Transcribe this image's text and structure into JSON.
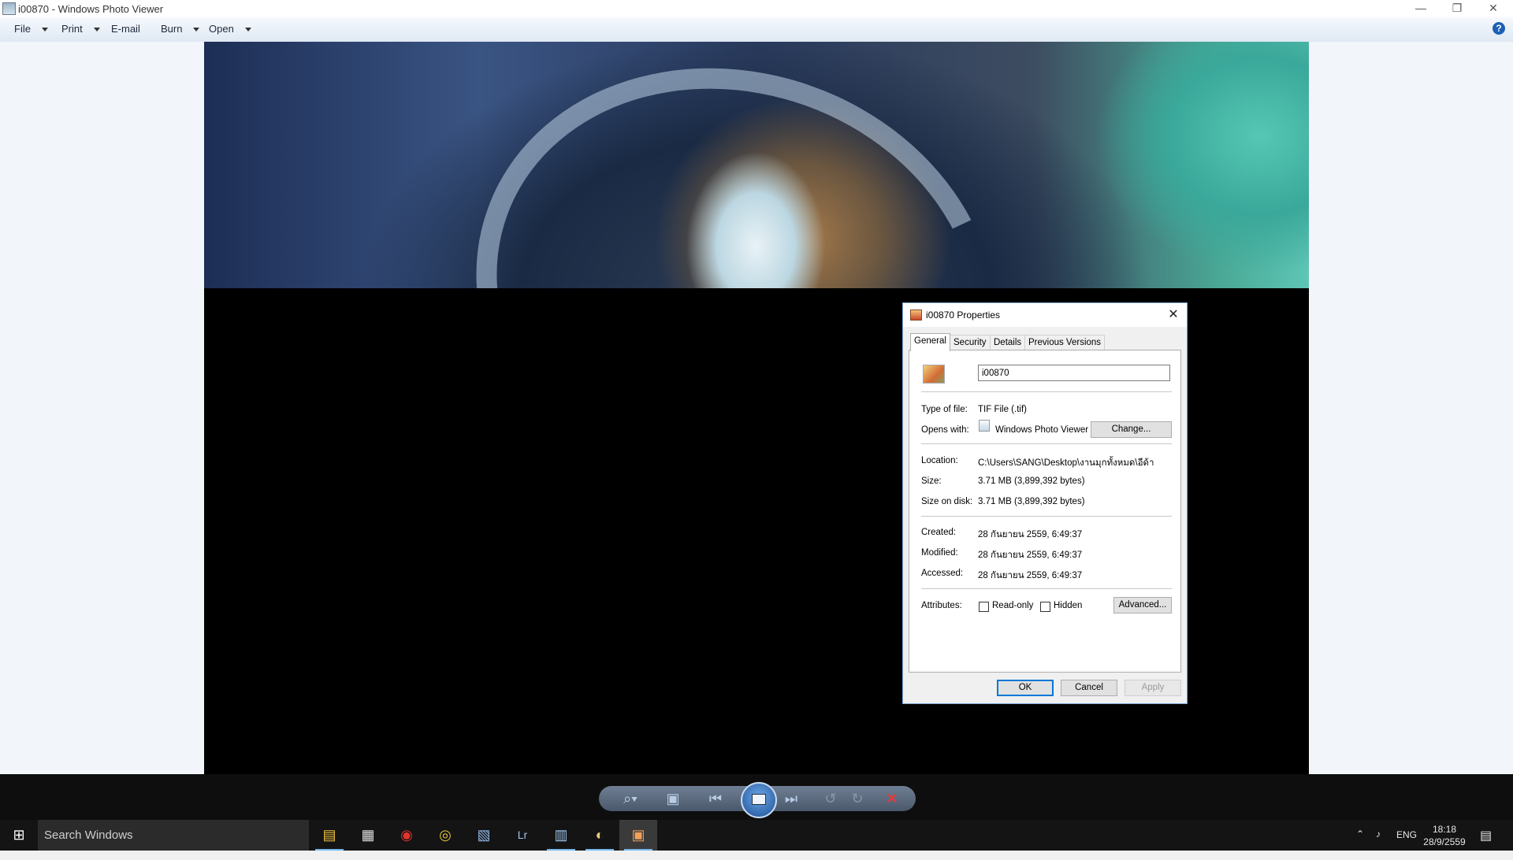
{
  "window": {
    "title": "i00870 - Windows Photo Viewer",
    "minimize": "—",
    "restore": "❐",
    "close": "✕"
  },
  "menu": {
    "items": [
      "File",
      "Print",
      "E-mail",
      "Burn",
      "Open"
    ],
    "help": "?"
  },
  "dialog": {
    "title": "i00870 Properties",
    "close": "✕",
    "tabs": [
      "General",
      "Security",
      "Details",
      "Previous Versions"
    ],
    "file_name": "i00870",
    "fields": {
      "type_label": "Type of file:",
      "type_value": "TIF File (.tif)",
      "opens_label": "Opens with:",
      "opens_value": "Windows Photo Viewer",
      "change_button": "Change...",
      "location_label": "Location:",
      "location_value": "C:\\Users\\SANG\\Desktop\\งานมุกทั้งหมด\\อีด้า",
      "size_label": "Size:",
      "size_value": "3.71 MB (3,899,392 bytes)",
      "size_disk_label": "Size on disk:",
      "size_disk_value": "3.71 MB (3,899,392 bytes)",
      "created_label": "Created:",
      "created_value": "28 กันยายน 2559, 6:49:37",
      "modified_label": "Modified:",
      "modified_value": "28 กันยายน 2559, 6:49:37",
      "accessed_label": "Accessed:",
      "accessed_value": "28 กันยายน 2559, 6:49:37",
      "attributes_label": "Attributes:",
      "readonly_label": "Read-only",
      "hidden_label": "Hidden",
      "advanced_button": "Advanced..."
    },
    "buttons": {
      "ok": "OK",
      "cancel": "Cancel",
      "apply": "Apply"
    }
  },
  "controls": {
    "zoom": "⌕▾",
    "fit": "▣",
    "previous": "⏮",
    "next": "⏭",
    "rotate_ccw": "↺",
    "rotate_cw": "↻",
    "delete": "✕"
  },
  "taskbar": {
    "start": "⊞",
    "search_placeholder": "Search Windows",
    "apps": [
      "▤",
      "▦",
      "◉",
      "◎",
      "▧",
      "Lr",
      "▥",
      "◐",
      "▣"
    ],
    "tray_chevron": "⌃",
    "tray_volume": "♪",
    "language": "ENG",
    "time": "18:18",
    "date": "28/9/2559",
    "notifications": "▤"
  }
}
